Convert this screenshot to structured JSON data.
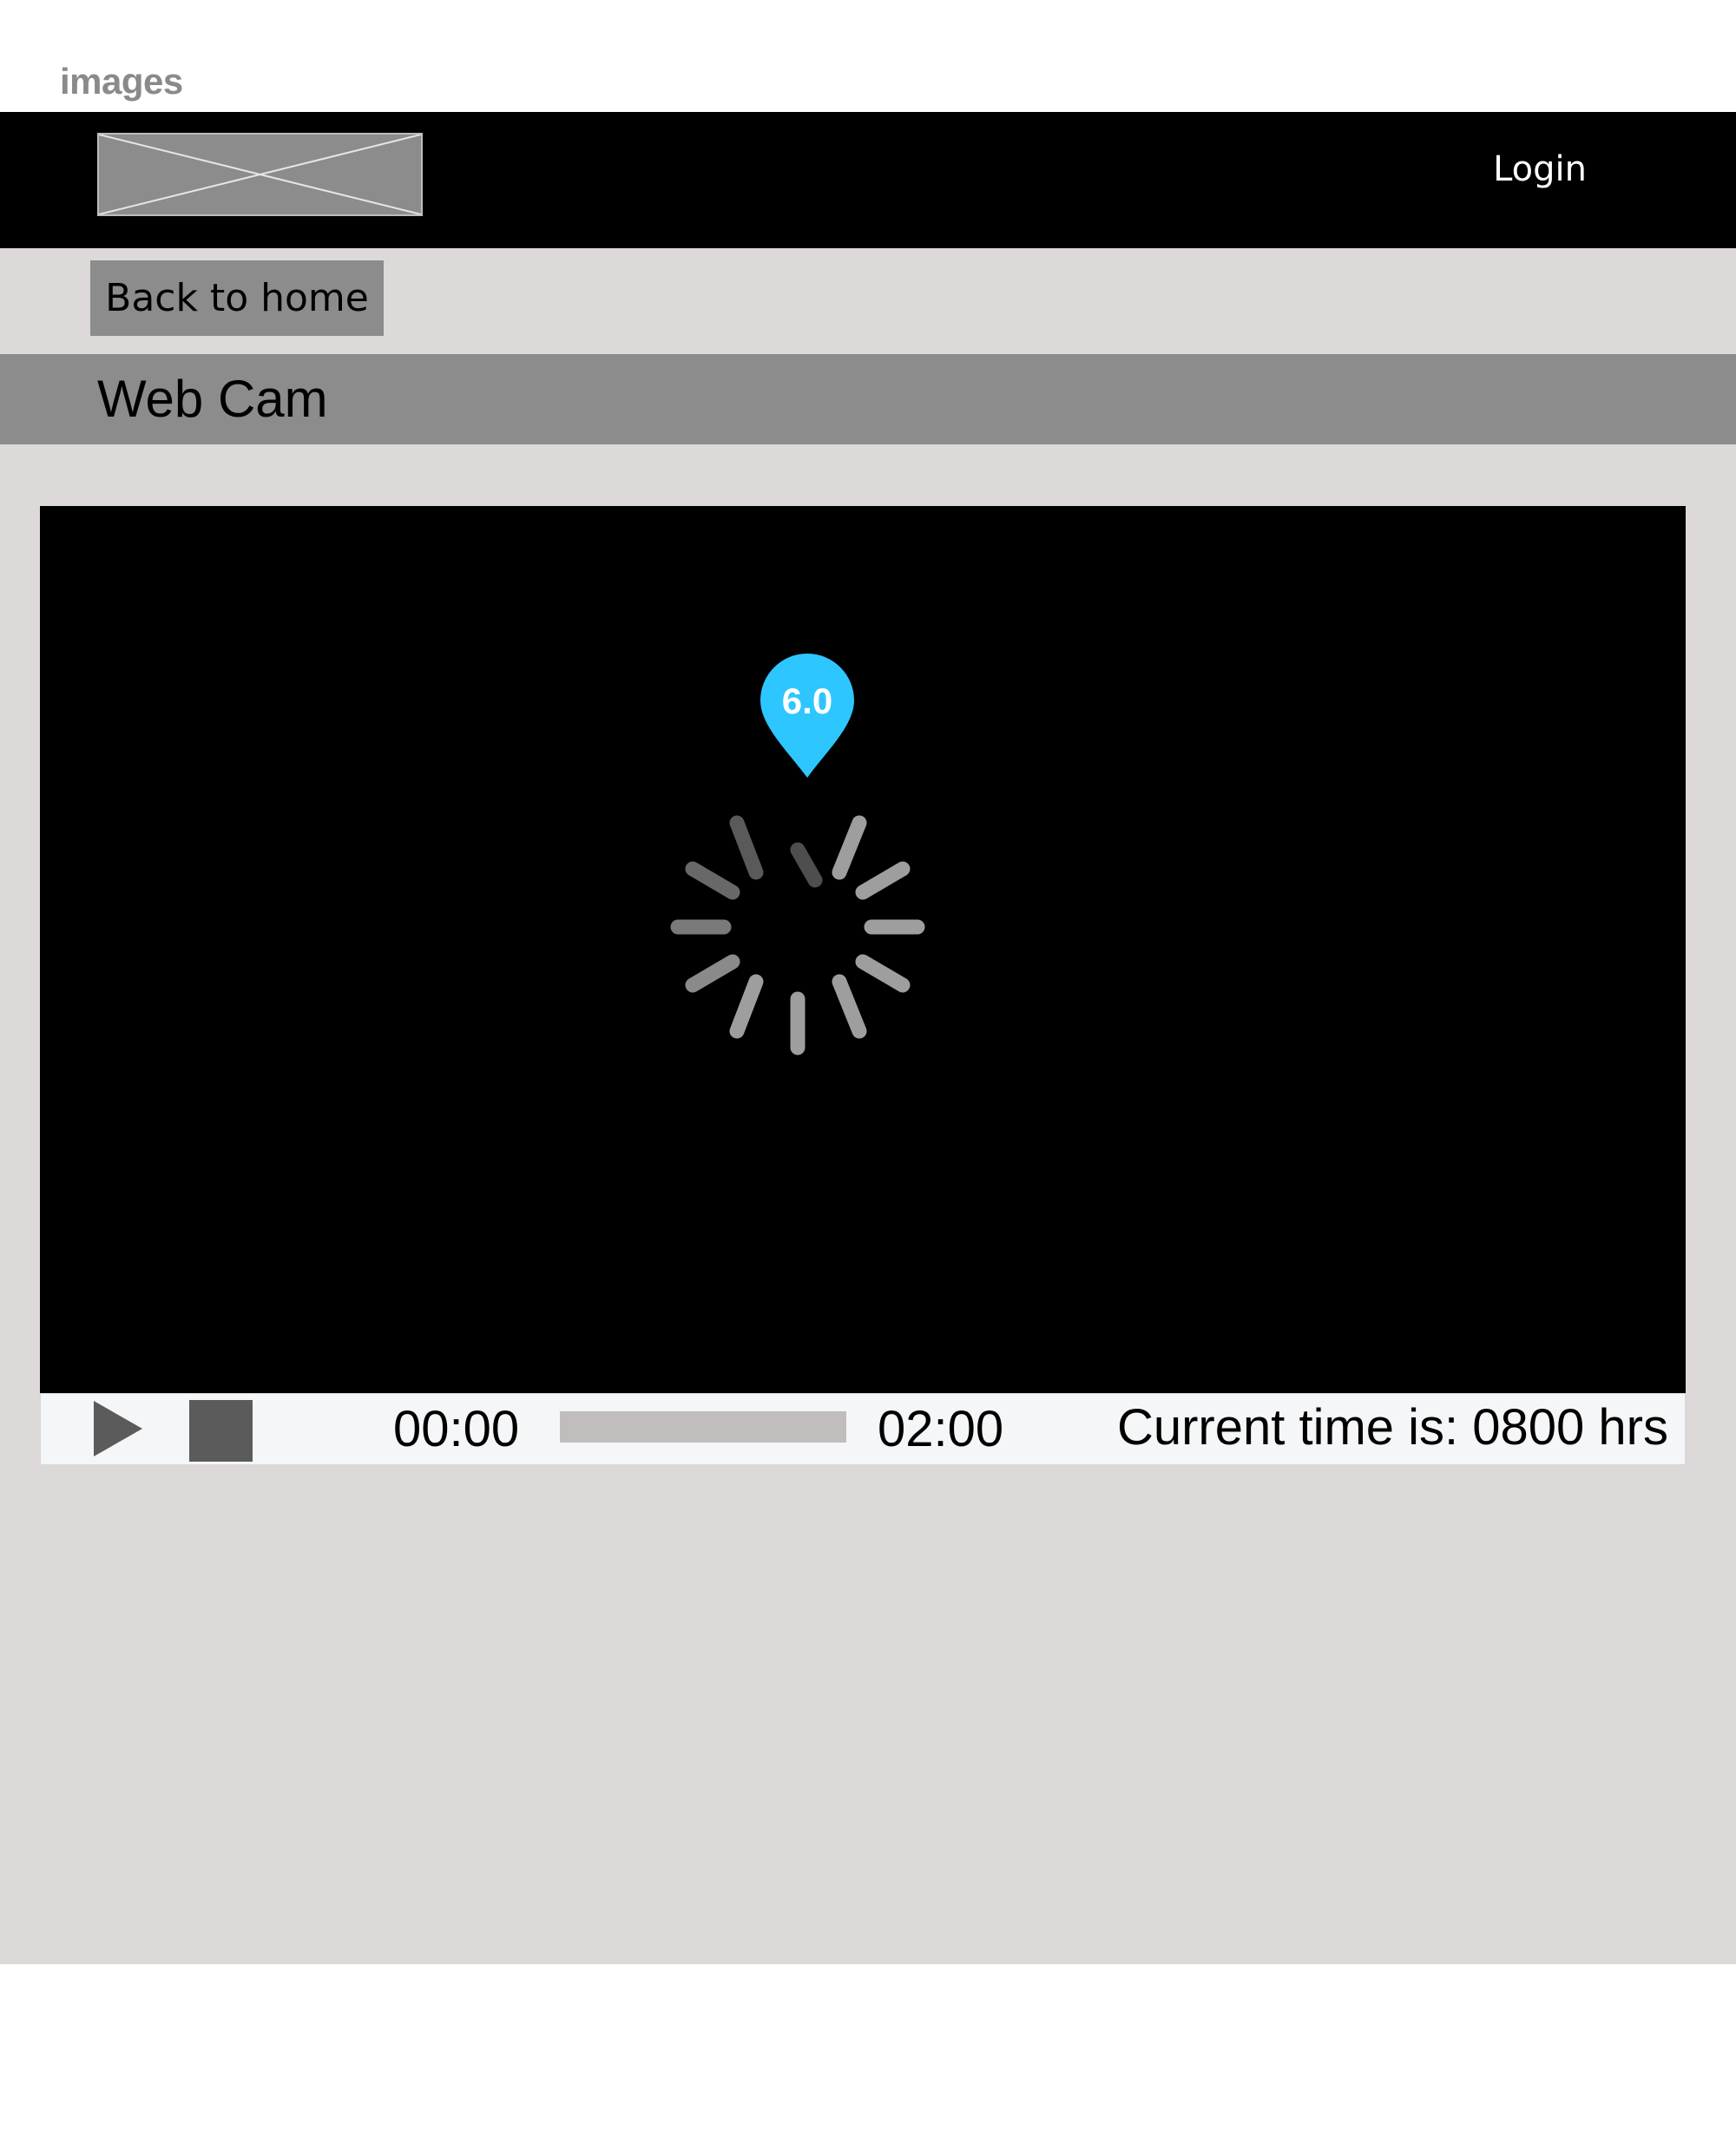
{
  "page": {
    "caption": "images"
  },
  "header": {
    "logo_icon": "image-placeholder-icon",
    "login_label": "Login"
  },
  "nav": {
    "back_label": "Back to home"
  },
  "section": {
    "title": "Web Cam"
  },
  "player": {
    "state": "loading",
    "loading_icon": "spinner-icon",
    "marker_icon": "map-pin-icon",
    "marker_label": "6.0",
    "marker_color": "#2ec6ff",
    "play_icon": "play-icon",
    "stop_icon": "stop-icon",
    "time_start": "00:00",
    "time_end": "02:00",
    "progress_fraction": 0,
    "current_time_text": "Current time is: 0800 hrs"
  }
}
